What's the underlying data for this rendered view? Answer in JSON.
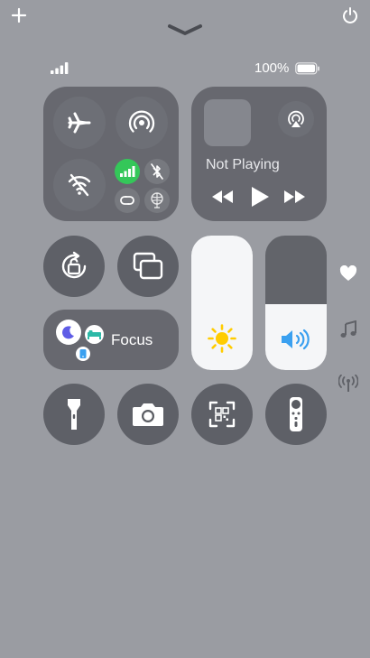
{
  "status": {
    "battery_percent": "100%",
    "cellular_bars": 4
  },
  "media": {
    "title": "Not Playing"
  },
  "focus": {
    "label": "Focus"
  },
  "sliders": {
    "brightness_level": 1.0,
    "volume_level": 0.49
  },
  "colors": {
    "background": "#9a9ca2",
    "green": "#34c759",
    "sun": "#ffcc00",
    "speaker": "#3aa0f0"
  },
  "icons": [
    "add-icon",
    "power-icon",
    "chevron-down-icon",
    "airplane-icon",
    "airdrop-icon",
    "wifi-off-icon",
    "cellular-icon",
    "bluetooth-off-icon",
    "personal-hotspot-icon",
    "vpn-icon",
    "airplay-icon",
    "rewind-icon",
    "play-icon",
    "fast-forward-icon",
    "orientation-lock-icon",
    "screen-mirroring-icon",
    "moon-icon",
    "bed-icon",
    "phone-icon",
    "sun-icon",
    "speaker-icon",
    "heart-icon",
    "music-note-icon",
    "antenna-icon",
    "flashlight-icon",
    "camera-icon",
    "qr-code-icon",
    "remote-icon"
  ]
}
